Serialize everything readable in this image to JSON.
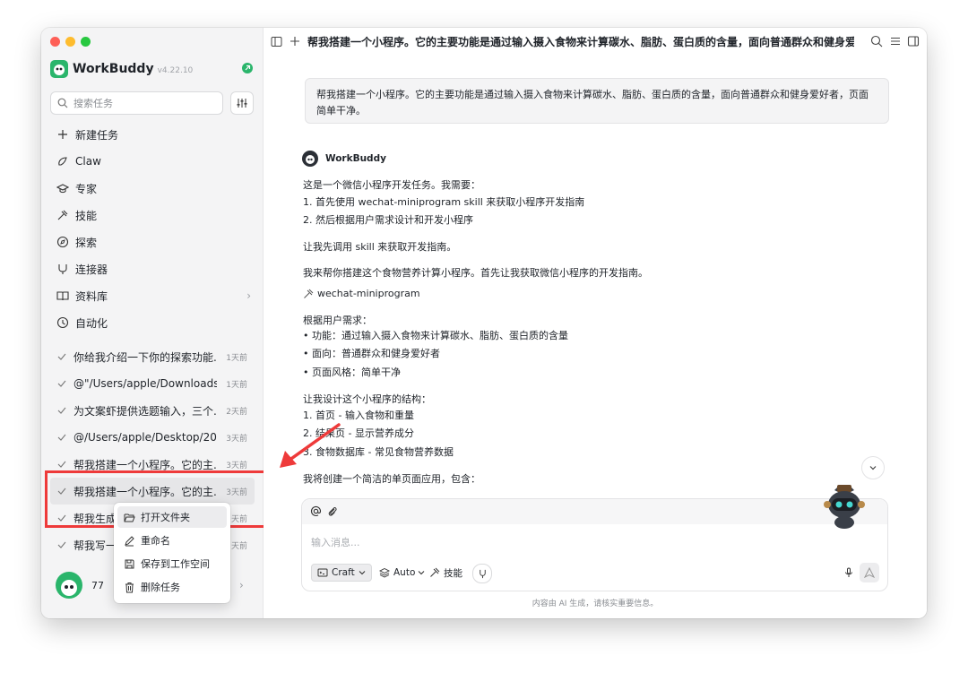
{
  "app": {
    "name": "WorkBuddy",
    "version": "v4.22.10"
  },
  "sidebar": {
    "search_placeholder": "搜索任务",
    "nav": [
      {
        "label": "新建任务",
        "icon": "plus-icon"
      },
      {
        "label": "Claw",
        "icon": "claw-icon"
      },
      {
        "label": "专家",
        "icon": "expert-icon"
      },
      {
        "label": "技能",
        "icon": "skill-icon"
      },
      {
        "label": "探索",
        "icon": "compass-icon"
      },
      {
        "label": "连接器",
        "icon": "connector-icon"
      },
      {
        "label": "资料库",
        "icon": "book-icon",
        "arrow": "›"
      },
      {
        "label": "自动化",
        "icon": "clock-icon"
      }
    ],
    "tasks": [
      {
        "title": "你给我介绍一下你的探索功能...",
        "time": "1天前"
      },
      {
        "title": "@\"/Users/apple/Downloads/...",
        "time": "1天前"
      },
      {
        "title": "为文案虾提供选题输入，三个...",
        "time": "2天前"
      },
      {
        "title": "@/Users/apple/Desktop/202...",
        "time": "3天前"
      },
      {
        "title": "帮我搭建一个小程序。它的主...",
        "time": "3天前"
      },
      {
        "title": "帮我搭建一个小程序。它的主...",
        "time": "3天前"
      },
      {
        "title": "帮我生成",
        "time": "天前"
      },
      {
        "title": "帮我写一",
        "time": "天前"
      }
    ],
    "user": {
      "name": "77",
      "arrow": "›"
    }
  },
  "context_menu": {
    "items": [
      {
        "label": "打开文件夹",
        "icon": "folder-open-icon"
      },
      {
        "label": "重命名",
        "icon": "pencil-icon"
      },
      {
        "label": "保存到工作空间",
        "icon": "save-icon"
      },
      {
        "label": "删除任务",
        "icon": "trash-icon"
      }
    ]
  },
  "main": {
    "title": "帮我搭建一个小程序。它的主要功能是通过输入摄入食物来计算碳水、脂肪、蛋白质的含量，面向普通群众和健身爱好...",
    "user_message": "帮我搭建一个小程序。它的主要功能是通过输入摄入食物来计算碳水、脂肪、蛋白质的含量，面向普通群众和健身爱好者，页面简单干净。",
    "agent_name": "WorkBuddy",
    "lines": [
      "这是一个微信小程序开发任务。我需要：",
      "1. 首先使用 wechat-miniprogram skill 来获取小程序开发指南",
      "2. 然后根据用户需求设计和开发小程序",
      "让我先调用 skill 来获取开发指南。",
      "我来帮你搭建这个食物营养计算小程序。首先让我获取微信小程序的开发指南。",
      "wechat-miniprogram",
      "根据用户需求：",
      "• 功能：通过输入摄入食物来计算碳水、脂肪、蛋白质的含量",
      "• 面向：普通群众和健身爱好者",
      "• 页面风格：简单干净",
      "让我设计这个小程序的结构：",
      "1. 首页 - 输入食物和重量",
      "2. 结果页 - 显示营养成分",
      "3. 食物数据库 - 常见食物营养数据",
      "我将创建一个简洁的单页面应用，包含："
    ],
    "composer": {
      "placeholder": "输入消息...",
      "mode": "Craft",
      "model": "Auto",
      "skills": "技能"
    },
    "footer": "内容由 AI 生成，请核实重要信息。"
  },
  "colors": {
    "brand": "#2ab56b",
    "annotation": "#ee3a3a",
    "selected": "#e6e6e8"
  }
}
